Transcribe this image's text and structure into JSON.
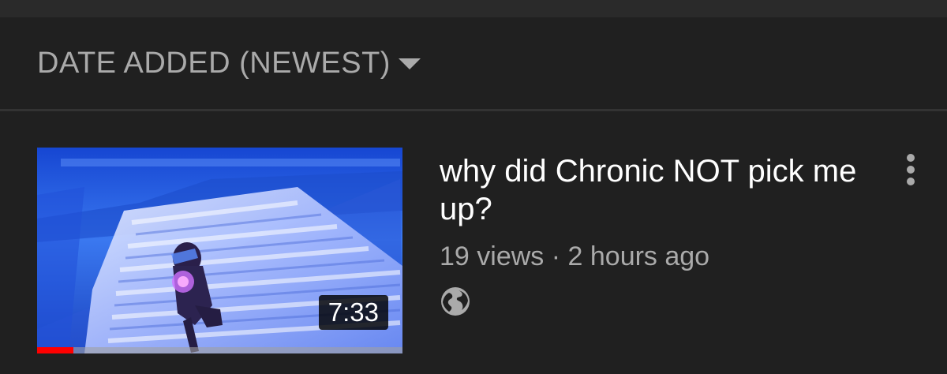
{
  "sort": {
    "label": "DATE ADDED (NEWEST)",
    "caret_icon": "caret-down-icon"
  },
  "video": {
    "title": "why did Chronic NOT pick me up?",
    "views": "19 views",
    "separator": "·",
    "uploaded": "2 hours ago",
    "duration": "7:33",
    "watch_progress": 0.1,
    "visibility_icon": "globe-icon",
    "menu_icon": "more-vert-icon",
    "progress_color": "#ff0000"
  }
}
